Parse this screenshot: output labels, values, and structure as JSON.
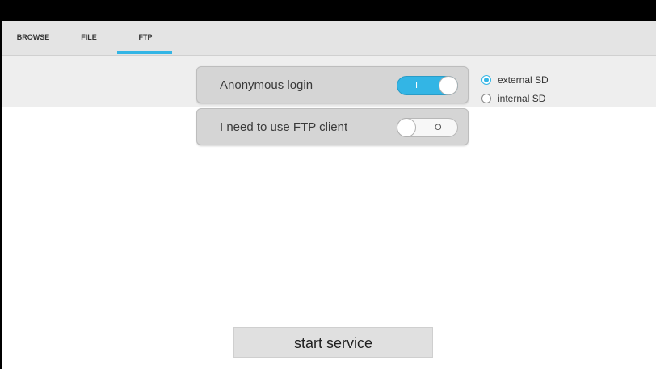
{
  "tabs": {
    "browse": "BROWSE",
    "file": "FILE",
    "ftp": "FTP",
    "active": "FTP"
  },
  "settings": {
    "anonymous_login": {
      "label": "Anonymous login",
      "toggle_text": "I",
      "state": "on"
    },
    "ftp_client": {
      "label": "I need to use FTP client",
      "toggle_text": "O",
      "state": "off"
    }
  },
  "storage": {
    "external": "external SD",
    "internal": "internal SD",
    "selected": "external SD"
  },
  "actions": {
    "start_service": "start service"
  },
  "colors": {
    "accent": "#33b5e5",
    "tab_bar": "#e4e4e4",
    "card": "#d5d5d5"
  }
}
